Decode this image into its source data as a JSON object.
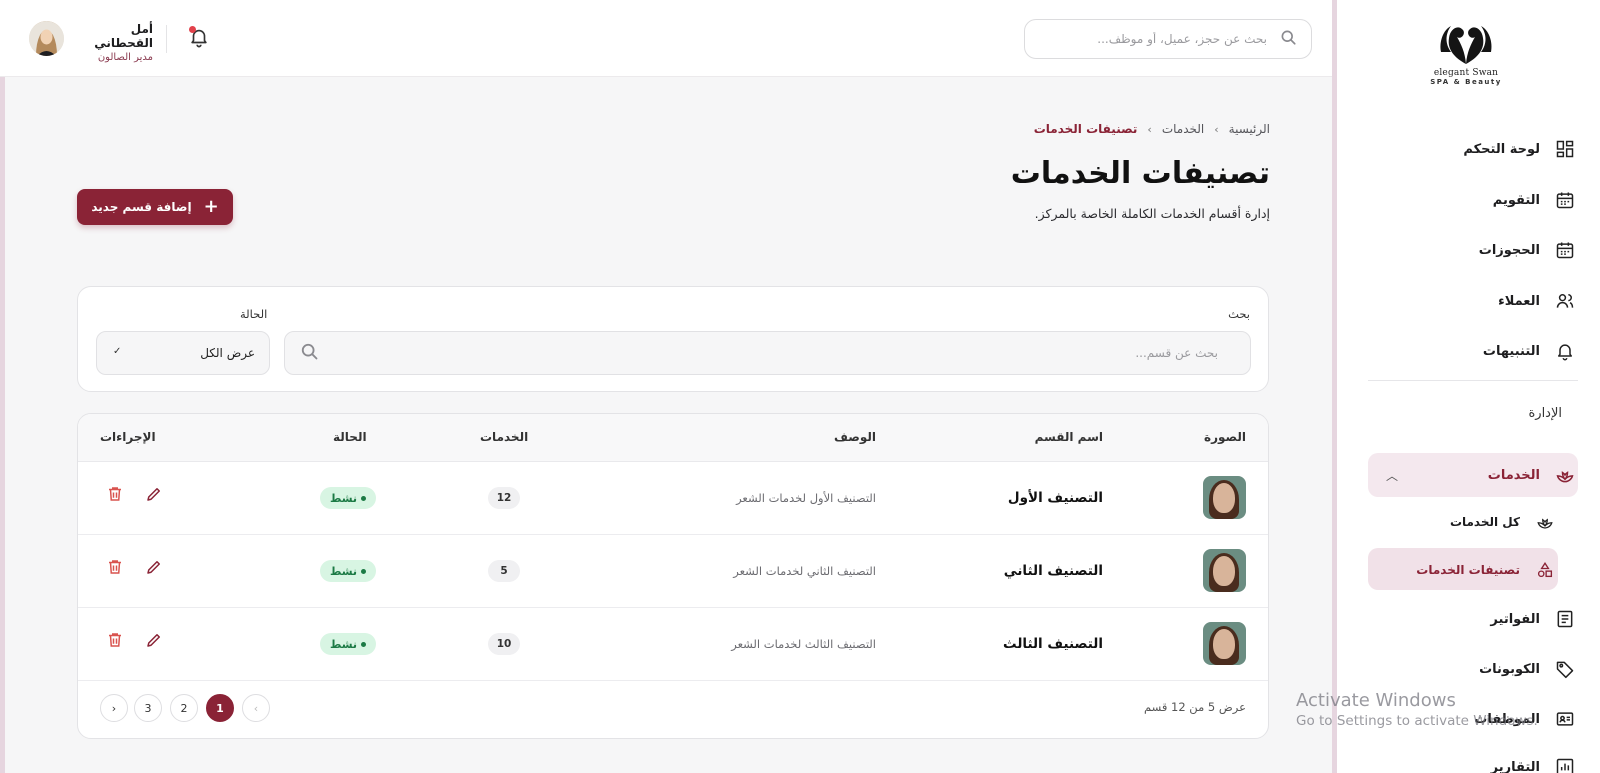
{
  "topbar": {
    "search_placeholder": "بحث عن حجز، عميل، أو موظف...",
    "user_name": "أمل القحطاني",
    "user_role": "مدير الصالون"
  },
  "logo": {
    "line1": "elegant Swan",
    "line2": "SPA & Beauty"
  },
  "sidebar": {
    "items": [
      {
        "label": "لوحة التحكم",
        "icon": "dashboard-icon"
      },
      {
        "label": "التقويم",
        "icon": "calendar-icon"
      },
      {
        "label": "الحجوزات",
        "icon": "calendar-icon"
      },
      {
        "label": "العملاء",
        "icon": "users-icon"
      },
      {
        "label": "التنبيهات",
        "icon": "bell-icon"
      }
    ],
    "section_label": "الإدارة",
    "services_label": "الخدمات",
    "sub_items": [
      {
        "label": "كل الخدمات",
        "icon": "lotus-icon"
      },
      {
        "label": "تصنيفات الخدمات",
        "icon": "shapes-icon"
      }
    ],
    "items_after": [
      {
        "label": "الفواتير",
        "icon": "invoice-icon"
      },
      {
        "label": "الكوبونات",
        "icon": "tag-icon"
      },
      {
        "label": "الموظفات",
        "icon": "id-card-icon"
      },
      {
        "label": "التقارير",
        "icon": "chart-icon"
      }
    ]
  },
  "breadcrumb": {
    "home": "الرئيسية",
    "services": "الخدمات",
    "current": "تصنيفات الخدمات"
  },
  "page": {
    "title": "تصنيفات الخدمات",
    "subtitle": "إدارة أقسام الخدمات الكاملة الخاصة بالمركز.",
    "add_button": "إضافة قسم جديد"
  },
  "filters": {
    "search_label": "بحث",
    "search_placeholder": "بحث عن قسم...",
    "status_label": "الحالة",
    "status_value": "عرض الكل"
  },
  "table": {
    "headers": {
      "image": "الصورة",
      "name": "اسم القسم",
      "description": "الوصف",
      "services": "الخدمات",
      "status": "الحالة",
      "actions": "الإجراءات"
    },
    "rows": [
      {
        "name": "التصنيف الأول",
        "description": "التصنيف الأول لخدمات الشعر",
        "services": "12",
        "status": "نشط"
      },
      {
        "name": "التصنيف الثاني",
        "description": "التصنيف الثاني لخدمات الشعر",
        "services": "5",
        "status": "نشط"
      },
      {
        "name": "التصنيف الثالث",
        "description": "التصنيف الثالث لخدمات الشعر",
        "services": "10",
        "status": "نشط"
      }
    ],
    "pagination_info": "عرض 5 من 12 قسم",
    "pages": [
      "1",
      "2",
      "3"
    ],
    "prev": "‹",
    "next": "›"
  },
  "colors": {
    "brand": "#8a2336",
    "active_bg": "#f4e8ee",
    "status_bg": "#d8f5e3",
    "status_text": "#1c7a45",
    "delete": "#d9534f"
  },
  "watermark": {
    "line1": "Activate Windows",
    "line2": "Go to Settings to activate Windows."
  }
}
